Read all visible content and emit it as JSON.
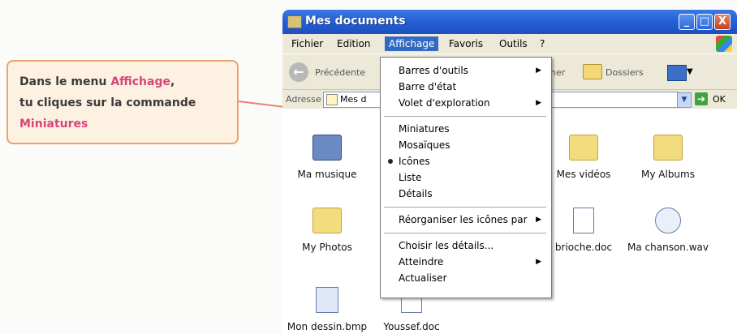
{
  "callout": {
    "line1_prefix": "Dans le menu ",
    "line1_highlight": "Affichage",
    "line1_suffix": ",",
    "line2": "tu cliques sur la commande",
    "line3_highlight": "Miniatures",
    "highlight_color": "#d8447a"
  },
  "window": {
    "title": "Mes documents",
    "controls": {
      "minimize": "_",
      "maximize": "□",
      "close": "X"
    }
  },
  "menubar": {
    "items": [
      "Fichier",
      "Edition",
      "Affichage",
      "Favoris",
      "Outils",
      "?"
    ],
    "active": "Affichage"
  },
  "toolbar": {
    "back_label": "Précédente",
    "search_label_fragment": "her",
    "folders_label": "Dossiers"
  },
  "addressbar": {
    "label": "Adresse",
    "value": "Mes d",
    "go_label": "OK"
  },
  "dropdown": {
    "group1": [
      {
        "label": "Barres d'outils",
        "submenu": true
      },
      {
        "label": "Barre d'état",
        "submenu": false
      },
      {
        "label": "Volet d'exploration",
        "submenu": true
      }
    ],
    "group2": [
      {
        "label": "Miniatures",
        "selected": false
      },
      {
        "label": "Mosaïques",
        "selected": false
      },
      {
        "label": "Icônes",
        "selected": true
      },
      {
        "label": "Liste",
        "selected": false
      },
      {
        "label": "Détails",
        "selected": false
      }
    ],
    "group3": [
      {
        "label": "Réorganiser les icônes par",
        "submenu": true
      }
    ],
    "group4": [
      {
        "label": "Choisir les détails...",
        "submenu": false
      },
      {
        "label": "Atteindre",
        "submenu": true
      },
      {
        "label": "Actualiser",
        "submenu": false
      }
    ]
  },
  "files": [
    {
      "name": "Ma musique",
      "icon": "music-folder-icon"
    },
    {
      "name": "Mes vidéos",
      "icon": "video-folder-icon"
    },
    {
      "name": "My Albums",
      "icon": "folder-icon"
    },
    {
      "name": "My Photos",
      "icon": "folder-icon"
    },
    {
      "name": "brioche.doc",
      "icon": "word-document-icon"
    },
    {
      "name": "Ma chanson.wav",
      "icon": "audio-file-icon"
    },
    {
      "name": "Mon dessin.bmp",
      "icon": "bitmap-image-icon"
    },
    {
      "name": "Youssef.doc",
      "icon": "word-document-icon"
    }
  ],
  "colors": {
    "titlebar": "#245fd4",
    "menu_highlight": "#316ac5",
    "callout_border": "#e8a46e",
    "callout_bg": "#fdf1e2"
  }
}
